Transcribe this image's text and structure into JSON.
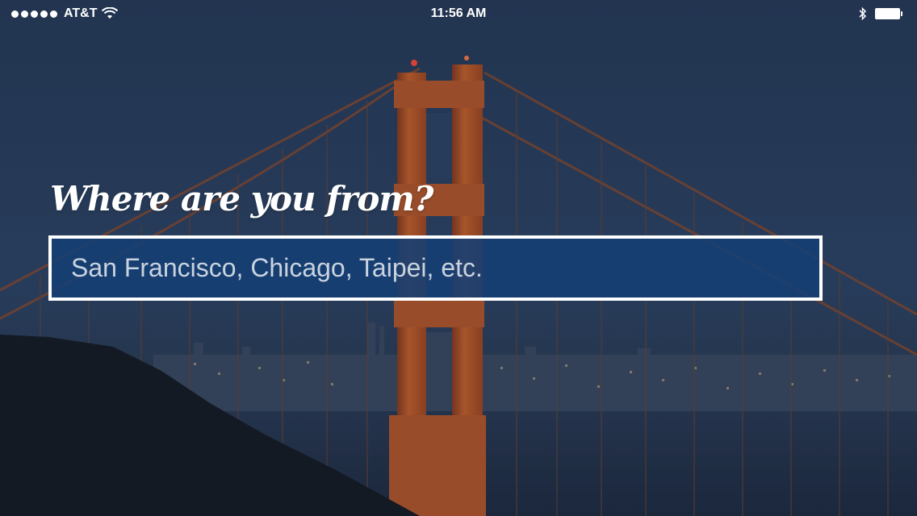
{
  "status_bar": {
    "carrier": "AT&T",
    "time": "11:56 AM",
    "signal_bars": 5,
    "battery_level": 1.0,
    "icons": [
      "signal-dots-icon",
      "wifi-icon",
      "bluetooth-icon",
      "battery-icon"
    ]
  },
  "prompt": {
    "title": "Where are you from?",
    "input_value": "",
    "input_placeholder": "San Francisco, Chicago, Taipei, etc."
  },
  "background": {
    "image": "golden-gate-bridge-night-photo",
    "overlay_color": "#1c2c44"
  },
  "colors": {
    "input_fill": "#153f74",
    "input_border": "#ffffff",
    "text": "#ffffff"
  }
}
